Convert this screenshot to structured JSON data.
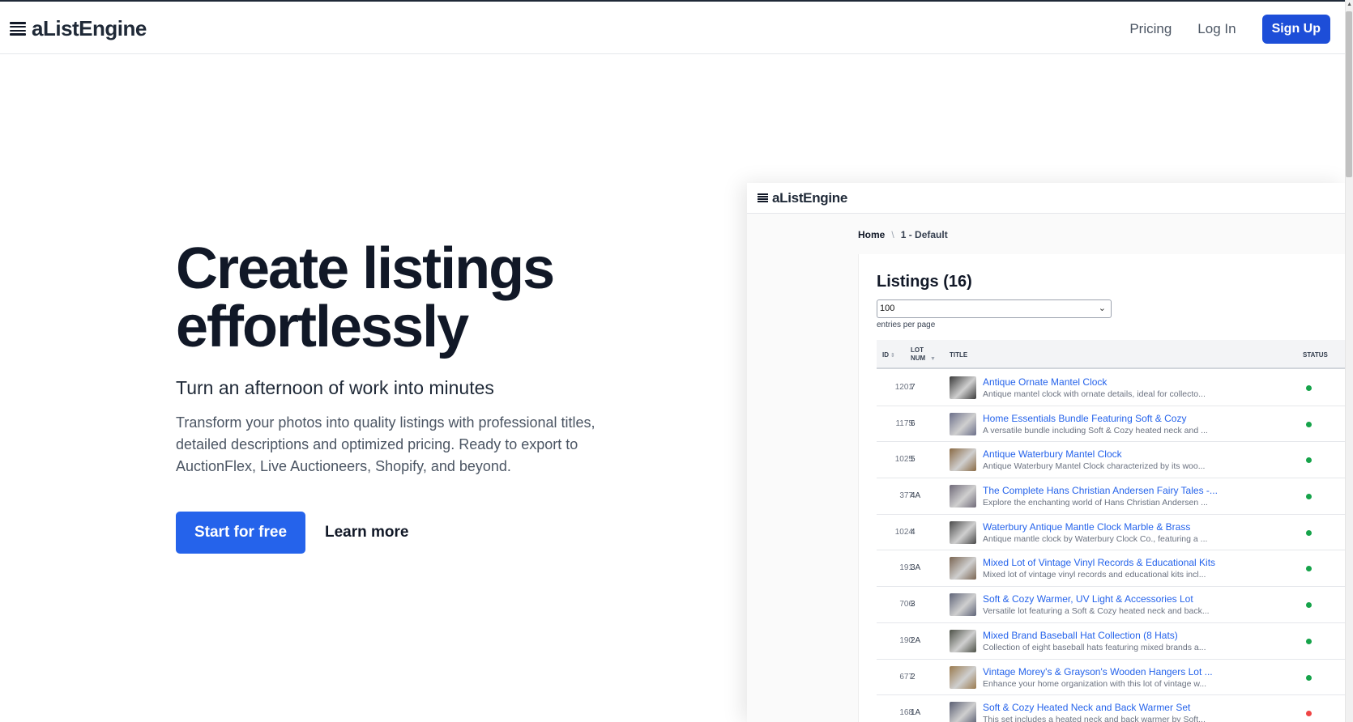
{
  "nav": {
    "logo": "aListEngine",
    "pricing": "Pricing",
    "login": "Log In",
    "signup": "Sign Up"
  },
  "hero": {
    "title_line1": "Create listings",
    "title_line2": "effortlessly",
    "subtitle": "Turn an afternoon of work into minutes",
    "description": "Transform your photos into quality listings with professional titles, detailed descriptions and optimized pricing. Ready to export to AuctionFlex, Live Auctioneers, Shopify, and beyond.",
    "cta_primary": "Start for free",
    "cta_secondary": "Learn more"
  },
  "preview": {
    "logo": "aListEngine",
    "breadcrumb": [
      "Home",
      "1 - Default"
    ],
    "heading": "Listings (16)",
    "entries_value": "100",
    "entries_label": "entries per page",
    "columns": [
      "ID",
      "LOT NUM",
      "TITLE",
      "STATUS"
    ],
    "rows": [
      {
        "id": "1201",
        "lot": "7",
        "title": "Antique Ornate Mantel Clock",
        "desc": "Antique mantel clock with ornate details, ideal for collecto...",
        "status": "active",
        "thumb": "#3a3a3a"
      },
      {
        "id": "1175",
        "lot": "6",
        "title": "Home Essentials Bundle Featuring Soft & Cozy",
        "desc": "A versatile bundle including Soft & Cozy heated neck and ...",
        "status": "active",
        "thumb": "#6b6f8a"
      },
      {
        "id": "1025",
        "lot": "5",
        "title": "Antique Waterbury Mantel Clock",
        "desc": "Antique Waterbury Mantel Clock characterized by its woo...",
        "status": "active",
        "thumb": "#8a6a44"
      },
      {
        "id": "377",
        "lot": "4A",
        "title": "The Complete Hans Christian Andersen Fairy Tales -...",
        "desc": "Explore the enchanting world of Hans Christian Andersen ...",
        "status": "active",
        "thumb": "#6f6a78"
      },
      {
        "id": "1024",
        "lot": "4",
        "title": "Waterbury Antique Mantle Clock Marble & Brass",
        "desc": "Antique mantle clock by Waterbury Clock Co., featuring a ...",
        "status": "active",
        "thumb": "#4a4a4a"
      },
      {
        "id": "191",
        "lot": "3A",
        "title": "Mixed Lot of Vintage Vinyl Records & Educational Kits",
        "desc": "Mixed lot of vintage vinyl records and educational kits incl...",
        "status": "active",
        "thumb": "#7a6552"
      },
      {
        "id": "706",
        "lot": "3",
        "title": "Soft & Cozy Warmer, UV Light & Accessories Lot",
        "desc": "Versatile lot featuring a Soft & Cozy heated neck and back...",
        "status": "active",
        "thumb": "#5f6478"
      },
      {
        "id": "190",
        "lot": "2A",
        "title": "Mixed Brand Baseball Hat Collection (8 Hats)",
        "desc": "Collection of eight baseball hats featuring mixed brands a...",
        "status": "active",
        "thumb": "#4d5147"
      },
      {
        "id": "677",
        "lot": "2",
        "title": "Vintage Morey's & Grayson's Wooden Hangers Lot ...",
        "desc": "Enhance your home organization with this lot of vintage w...",
        "status": "active",
        "thumb": "#9a7a4e"
      },
      {
        "id": "168",
        "lot": "1A",
        "title": "Soft & Cozy Heated Neck and Back Warmer Set",
        "desc": "This set includes a heated neck and back warmer by Soft...",
        "status": "inactive",
        "thumb": "#5a5e72"
      }
    ]
  },
  "colors": {
    "active": "#16a34a",
    "inactive": "#ef4444",
    "brand": "#1d4ed8"
  }
}
